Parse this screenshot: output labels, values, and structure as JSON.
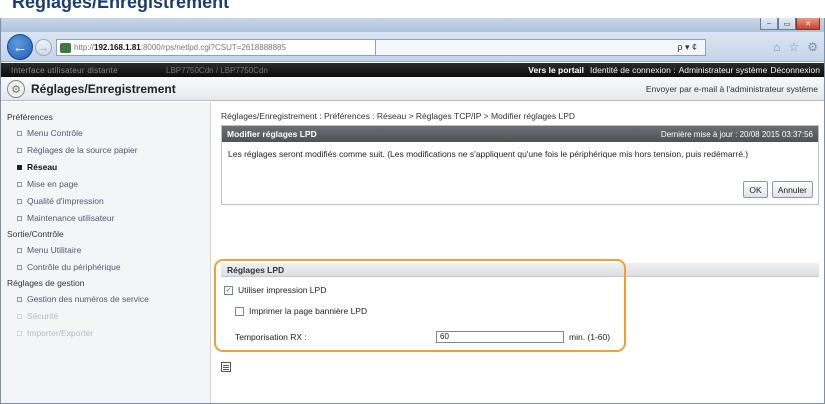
{
  "heading": {
    "text": "Réglages/Enregistrement"
  },
  "browser": {
    "address": {
      "prefix": "http://",
      "host": "192.168.1.81",
      "path": ":8000/rps/netlpd.cgi?CSUT=2618888885"
    },
    "search_controls": "ρ ▾ ¢",
    "window_buttons": [
      "–",
      "▭",
      "✕"
    ],
    "toolbar_icons": [
      "⌂",
      "☆",
      "⚙"
    ]
  },
  "portal": {
    "blurred_left": "Interface utilisateur distante",
    "blurred_mid": "LBP7750Cdn / LBP7750Cdn",
    "portal_link": "Vers le portail",
    "login_id_label": "Identité de connexion :",
    "login_id_value": "Administrateur système",
    "logout": "Déconnexion"
  },
  "header": {
    "title": "Réglages/Enregistrement",
    "mail_link": "Envoyer par e-mail à l'administrateur système"
  },
  "sidebar": {
    "sections": [
      {
        "label": "Préférences",
        "items": [
          {
            "label": "Menu Contrôle",
            "active": false
          },
          {
            "label": "Réglages de la source papier",
            "active": false
          },
          {
            "label": "Réseau",
            "active": true
          },
          {
            "label": "Mise en page",
            "active": false
          },
          {
            "label": "Qualité d'impression",
            "active": false
          },
          {
            "label": "Maintenance utilisateur",
            "active": false
          }
        ]
      },
      {
        "label": "Sortie/Contrôle",
        "items": [
          {
            "label": "Menu Utilitaire",
            "active": false
          },
          {
            "label": "Contrôle du périphérique",
            "active": false
          }
        ]
      },
      {
        "label": "Réglages de gestion",
        "items": [
          {
            "label": "Gestion des numéros de service",
            "active": false
          },
          {
            "label": "Sécurité",
            "active": false
          },
          {
            "label": "Importer/Exporter",
            "active": false
          }
        ]
      }
    ]
  },
  "main": {
    "breadcrumb": "Réglages/Enregistrement : Préférences : Réseau > Réglages TCP/IP > Modifier réglages LPD",
    "panel": {
      "title": "Modifier réglages LPD",
      "last_update": "Dernière mise à jour : 20/08 2015 03:37:56",
      "message": "Les réglages seront modifiés comme suit. (Les modifications ne s'appliquent qu'une fois le périphérique mis hors tension, puis redémarré.)",
      "ok_label": "OK",
      "cancel_label": "Annuler"
    },
    "lpd": {
      "heading": "Réglages LPD",
      "use_lpd_label": "Utiliser impression LPD",
      "use_lpd_checked": true,
      "banner_label": "Imprimer la page bannière LPD",
      "banner_checked": false,
      "rx_label": "Temporisation RX :",
      "rx_value": "60",
      "rx_unit": "min. (1-60)"
    }
  },
  "colors": {
    "highlight": "#f0a030",
    "portal_bar": "#111111",
    "panel_header": "#5a5c61"
  }
}
